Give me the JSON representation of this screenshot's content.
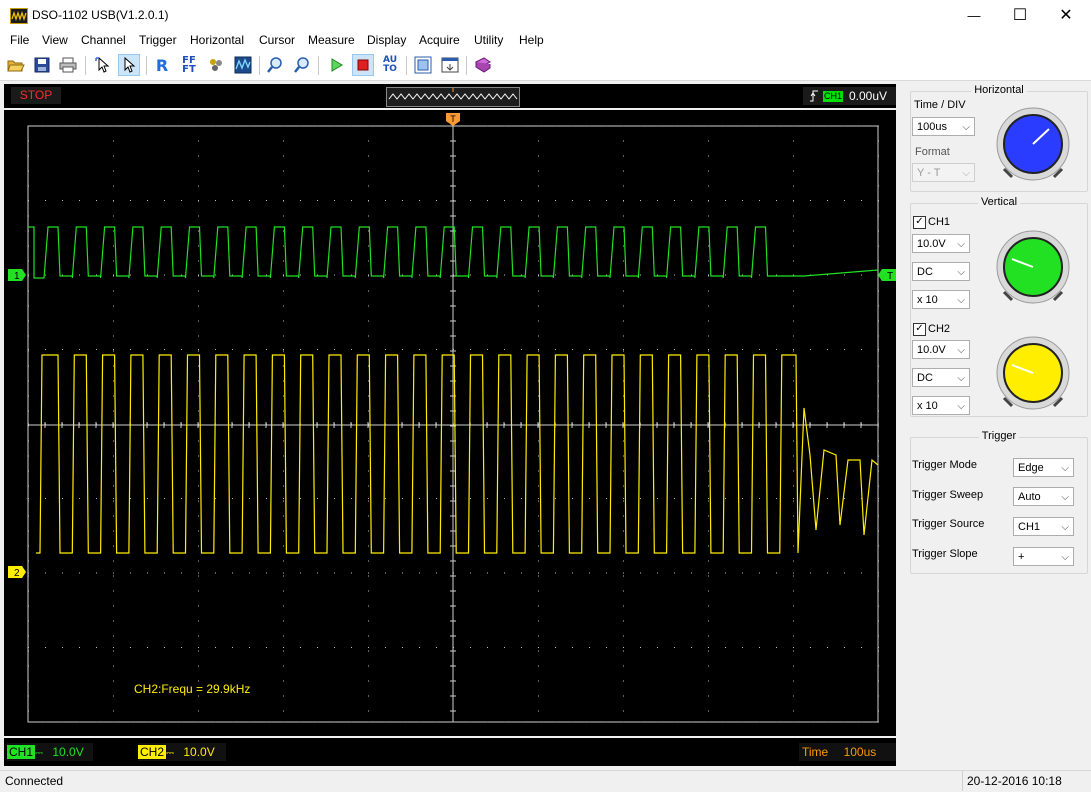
{
  "window": {
    "title": "DSO-1102 USB(V1.2.0.1)",
    "minimize": "—",
    "maximize": "☐",
    "close": "✕"
  },
  "menu": [
    "File",
    "View",
    "Channel",
    "Trigger",
    "Horizontal",
    "Cursor",
    "Measure",
    "Display",
    "Acquire",
    "Utility",
    "Help"
  ],
  "toolbar_icons": [
    "open-icon",
    "save-icon",
    "print-icon",
    "select-arrow-icon",
    "pointer-icon",
    "ref-icon",
    "fft-icon",
    "math-icon",
    "waveform-icon",
    "zoom-in-icon",
    "zoom-out-icon",
    "run-icon",
    "stop-icon",
    "auto-icon",
    "capture-icon",
    "export-icon",
    "book-icon"
  ],
  "status": {
    "run_state": "STOP",
    "trigger_channel": "CH1",
    "trigger_level": "0.00uV"
  },
  "scope": {
    "trigger_marker": "T",
    "ch1_marker": "1",
    "ch2_marker": "2",
    "trigger_level_marker": "T",
    "measurement": "CH2:Frequ = 29.9kHz",
    "colors": {
      "ch1": "#22e022",
      "ch2": "#ffee00",
      "grid": "#d0d0d0",
      "trigger_marker": "#ff9933"
    }
  },
  "bottom": {
    "ch1_label": "CH1",
    "ch1_coupling_glyph": "⎓",
    "ch1_volts": "10.0V",
    "ch2_label": "CH2",
    "ch2_coupling_glyph": "⎓",
    "ch2_volts": "10.0V",
    "time_label": "Time",
    "time_value": "100us"
  },
  "panel": {
    "horizontal": {
      "title": "Horizontal",
      "time_div_label": "Time / DIV",
      "time_div_value": "100us",
      "format_label": "Format",
      "format_value": "Y - T",
      "knob_color": "#2a3cff"
    },
    "vertical": {
      "title": "Vertical",
      "ch1": {
        "label": "CH1",
        "checked": "✓",
        "volts": "10.0V",
        "coupling": "DC",
        "probe": "x 10",
        "knob_color": "#22e022"
      },
      "ch2": {
        "label": "CH2",
        "checked": "✓",
        "volts": "10.0V",
        "coupling": "DC",
        "probe": "x 10",
        "knob_color": "#ffee00"
      }
    },
    "trigger": {
      "title": "Trigger",
      "mode_label": "Trigger Mode",
      "mode_value": "Edge",
      "sweep_label": "Trigger Sweep",
      "sweep_value": "Auto",
      "source_label": "Trigger Source",
      "source_value": "CH1",
      "slope_label": "Trigger Slope",
      "slope_value": "+"
    }
  },
  "statusbar": {
    "left": "Connected",
    "right": "20-12-2016  10:18"
  }
}
